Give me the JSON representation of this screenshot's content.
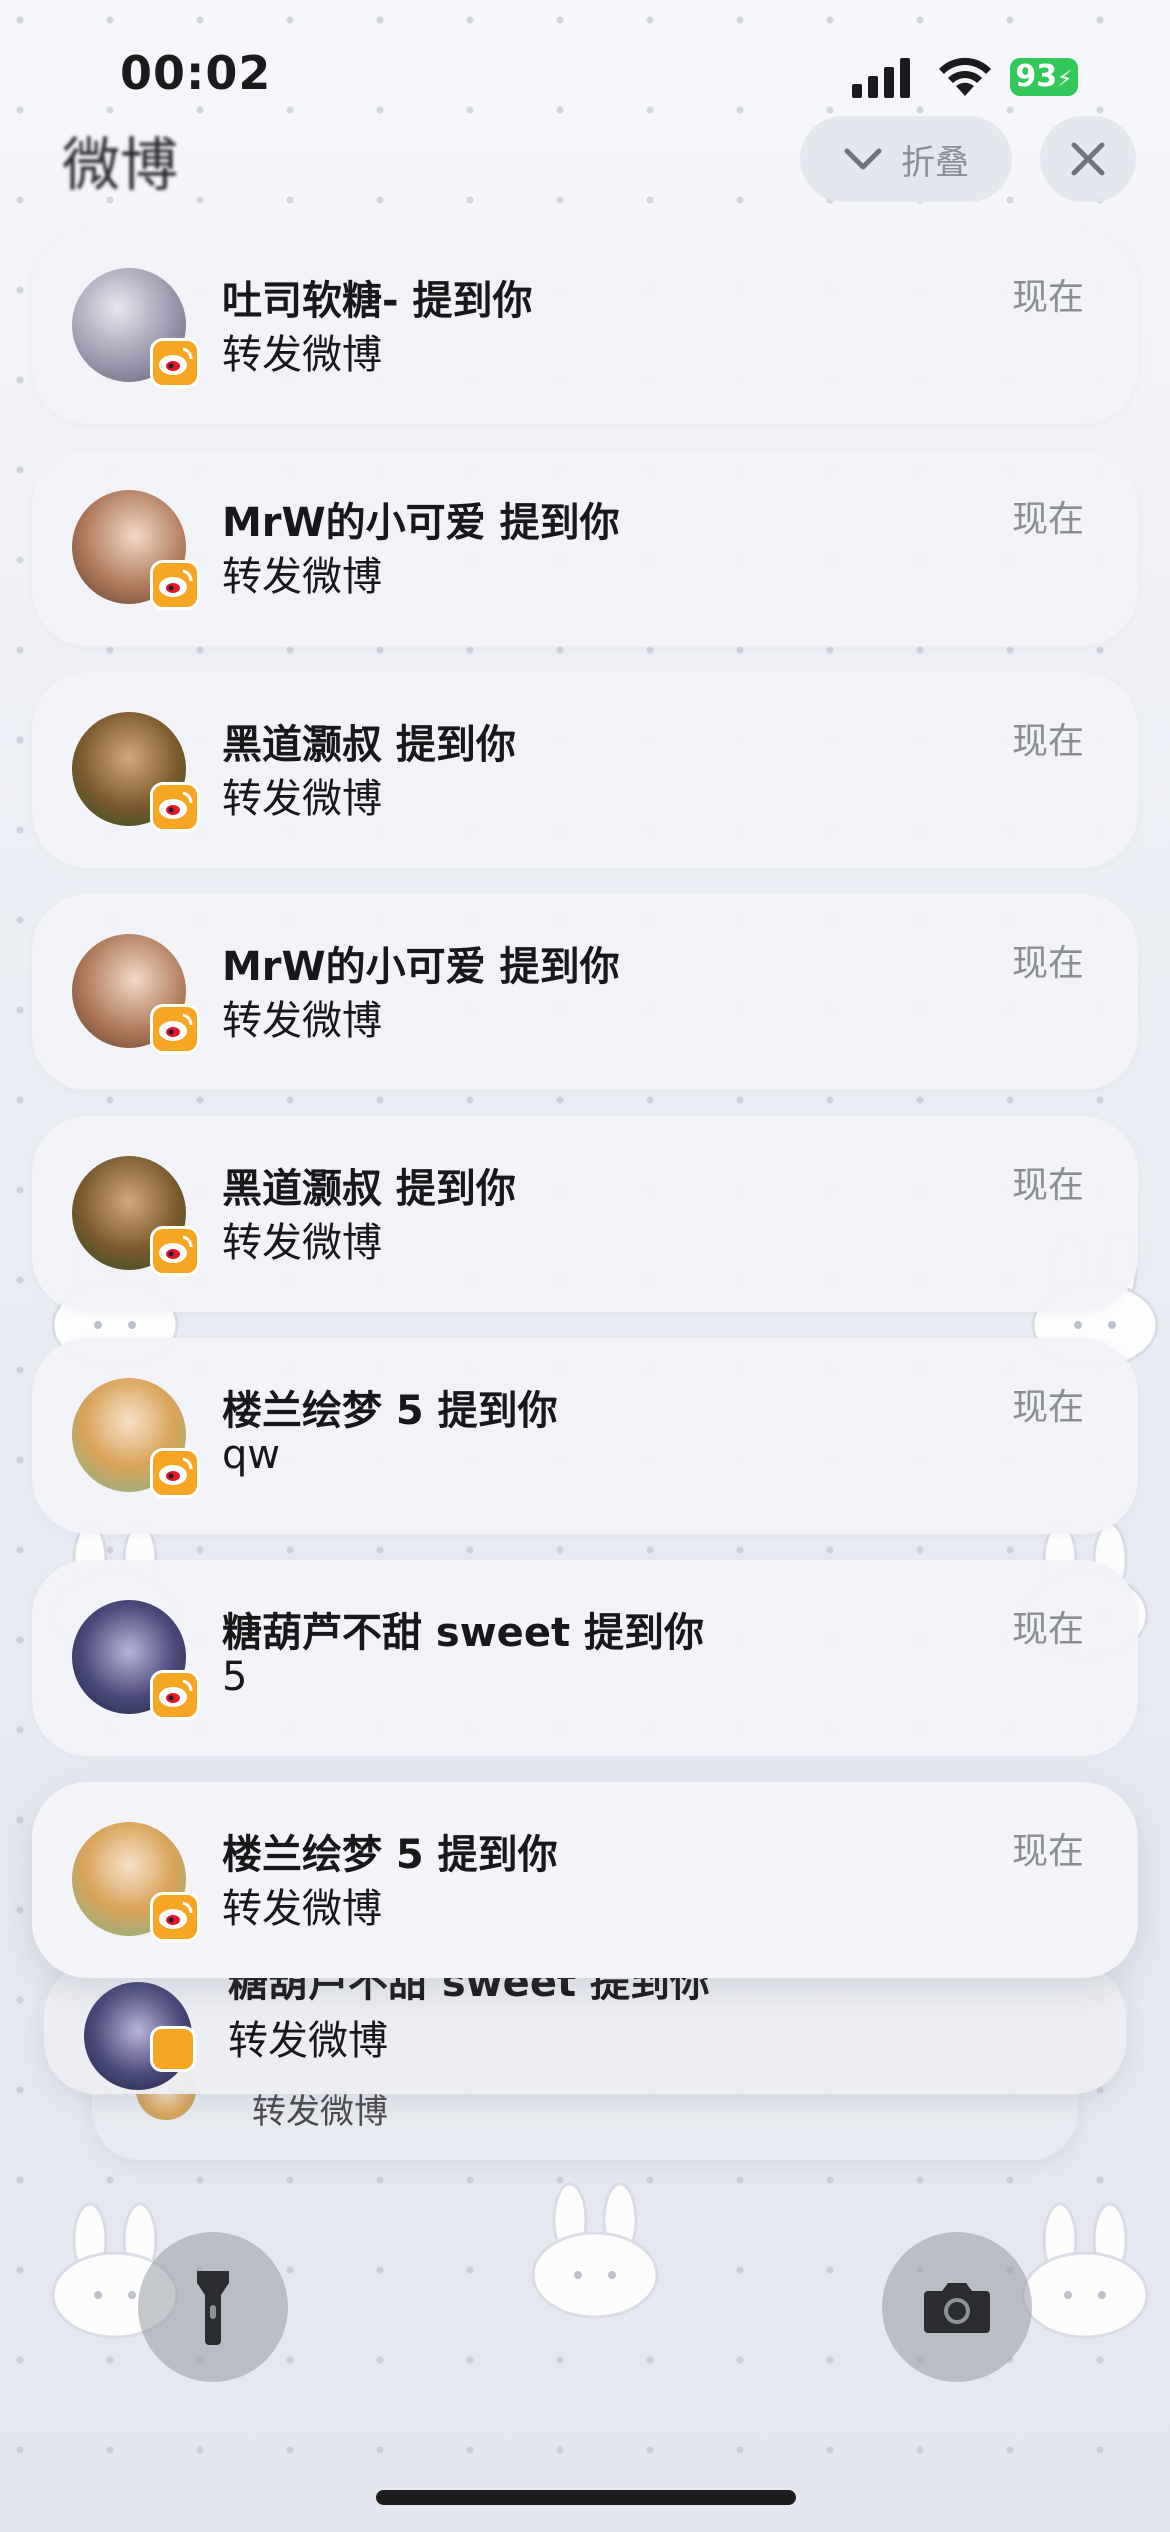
{
  "status_bar": {
    "time": "00:02",
    "battery": "93"
  },
  "header": {
    "app_name": "微博",
    "collapse_label": "折叠"
  },
  "notifications": [
    {
      "title": "吐司软糖- 提到你",
      "body": "转发微博",
      "time": "现在"
    },
    {
      "title": "MrW的小可爱 提到你",
      "body": "转发微博",
      "time": "现在"
    },
    {
      "title": "黑道灏叔 提到你",
      "body": "转发微博",
      "time": "现在"
    },
    {
      "title": "MrW的小可爱 提到你",
      "body": "转发微博",
      "time": "现在"
    },
    {
      "title": "黑道灏叔 提到你",
      "body": "转发微博",
      "time": "现在"
    },
    {
      "title": "楼兰绘梦 5 提到你",
      "body": "qw",
      "time": "现在"
    },
    {
      "title": "糖葫芦不甜 sweet 提到你",
      "body": "5",
      "time": "现在"
    },
    {
      "title": "楼兰绘梦 5 提到你",
      "body": "转发微博",
      "time": "现在"
    }
  ],
  "stacked": [
    {
      "title": "糖葫芦不甜 sweet 提到你",
      "body": "转发微博"
    },
    {
      "body": "转发微博"
    }
  ],
  "colors": {
    "accent_battery": "#34c759",
    "weibo_badge": "#f5a623",
    "weibo_red": "#e6162d"
  },
  "icons": [
    "signal-icon",
    "wifi-icon",
    "chevron-down-icon",
    "close-icon",
    "weibo-icon",
    "flashlight-icon",
    "camera-icon"
  ]
}
